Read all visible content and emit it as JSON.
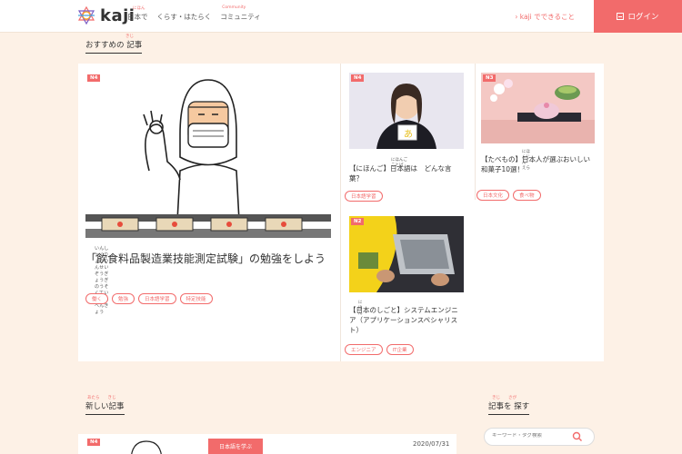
{
  "header": {
    "logo_text": "kaji",
    "nav": [
      {
        "label": "日本で",
        "ruby": "にほん"
      },
      {
        "label": "くらす・はたらく",
        "ruby": ""
      },
      {
        "label": "コミュニティ",
        "ruby": "Community"
      }
    ],
    "about_link": "› kaji でできること",
    "login_label": "ログイン"
  },
  "featured": {
    "title": "おすすめの 記事",
    "title_ruby": "きじ",
    "main_card": {
      "level": "N4",
      "title": "「飲食料品製造業技能測定試験」の勉強をしよう",
      "title_ruby": "いんしょくりょうひんせいぞうぎょうぎのうそくていしけん　　べんきょう",
      "chips": [
        "働く",
        "勉強",
        "日本語学習",
        "特定技能"
      ]
    },
    "card2": {
      "level": "N4",
      "title": "【にほんご】日本語は　どんな言葉？",
      "ruby": "にほんご　　　　ことば",
      "chips": [
        "日本語学習"
      ]
    },
    "card3": {
      "level": "N3",
      "title": "【たべもの】日本人が選ぶおいしい和菓子10選！",
      "ruby": "にほんじん　えら",
      "chips": [
        "日本文化",
        "食べ物"
      ]
    },
    "card4": {
      "level": "N2",
      "title": "【日本のしごと】システムエンジニア（アプリケーションスペシャリスト）",
      "ruby": "にほん",
      "chips": [
        "エンジニア",
        "IT企業"
      ]
    }
  },
  "latest": {
    "title": "新しい記事",
    "title_ruby": "あたら　　きじ",
    "card_level": "N4",
    "learn_button": "日本語を学ぶ",
    "date": "2020/07/31"
  },
  "search": {
    "title": "記事を 探す",
    "title_ruby": "きじ　　さが",
    "placeholder": "キーワード・タグ検索"
  },
  "colors": {
    "accent": "#f26b6b",
    "background": "#fdf1e6"
  }
}
